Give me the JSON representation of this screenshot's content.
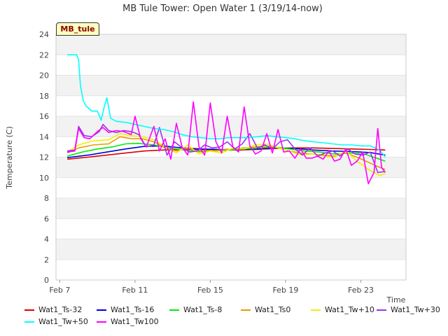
{
  "chart_data": {
    "type": "line",
    "title": "MB Tule Tower: Open Water 1 (3/19/14-now)",
    "xlabel": "Time",
    "ylabel": "Temperature (C)",
    "ylim": [
      0,
      24
    ],
    "yticks": [
      0,
      2,
      4,
      6,
      8,
      10,
      12,
      14,
      16,
      18,
      20,
      22,
      24
    ],
    "xlim": [
      6.8,
      25.4
    ],
    "xticks": [
      {
        "v": 7,
        "label": "Feb 7"
      },
      {
        "v": 11,
        "label": "Feb 11"
      },
      {
        "v": 15,
        "label": "Feb 15"
      },
      {
        "v": 19,
        "label": "Feb 19"
      },
      {
        "v": 23,
        "label": "Feb 23"
      }
    ],
    "badge": "MB_tule",
    "series": [
      {
        "name": "Wat1_Ts-32",
        "color": "#dd0000",
        "x": [
          7.4,
          8.5,
          9.5,
          10.5,
          11.5,
          12.5,
          13.5,
          14.5,
          15.5,
          16.5,
          17.5,
          18.5,
          19.5,
          20.5,
          21.5,
          22.5,
          23.5,
          24.3
        ],
        "y": [
          11.8,
          12.0,
          12.2,
          12.4,
          12.6,
          12.7,
          12.75,
          12.75,
          12.7,
          12.7,
          12.75,
          12.85,
          12.9,
          12.9,
          12.85,
          12.8,
          12.75,
          12.7
        ]
      },
      {
        "name": "Wat1_Ts-16",
        "color": "#0000dd",
        "x": [
          7.4,
          8.5,
          9.5,
          10.5,
          11.5,
          12.5,
          13.5,
          14.5,
          15.5,
          16.5,
          17.5,
          18.5,
          19.5,
          20.5,
          21.5,
          22.5,
          23.5,
          24.3
        ],
        "y": [
          11.95,
          12.2,
          12.5,
          12.8,
          13.05,
          13.1,
          12.9,
          12.8,
          12.75,
          12.75,
          12.8,
          12.9,
          12.85,
          12.7,
          12.6,
          12.55,
          12.45,
          12.2
        ]
      },
      {
        "name": "Wat1_Ts-8",
        "color": "#00ee00",
        "x": [
          7.4,
          8.2,
          9.0,
          9.8,
          10.5,
          11.2,
          12.0,
          12.8,
          13.6,
          14.4,
          15.2,
          16.0,
          16.8,
          17.6,
          18.4,
          19.2,
          20.0,
          20.8,
          21.6,
          22.4,
          23.2,
          24.3
        ],
        "y": [
          12.1,
          12.5,
          12.8,
          13.0,
          13.3,
          13.35,
          13.2,
          12.9,
          12.7,
          12.6,
          12.6,
          12.7,
          12.8,
          12.9,
          13.0,
          12.8,
          12.6,
          12.5,
          12.3,
          12.4,
          12.3,
          11.6
        ]
      },
      {
        "name": "Wat1_Ts0",
        "color": "#ee9900",
        "x": [
          7.4,
          8.0,
          8.8,
          9.6,
          10.2,
          10.8,
          11.4,
          12.0,
          12.6,
          13.2,
          13.8,
          14.4,
          15.0,
          15.6,
          16.2,
          16.8,
          17.4,
          18.0,
          18.6,
          19.2,
          19.8,
          20.4,
          21.0,
          21.6,
          22.2,
          22.8,
          23.4,
          24.0,
          24.3
        ],
        "y": [
          12.4,
          12.9,
          13.2,
          13.3,
          14.0,
          13.8,
          13.8,
          13.5,
          12.9,
          12.6,
          12.9,
          12.5,
          12.6,
          12.7,
          12.8,
          12.9,
          13.0,
          13.1,
          12.9,
          12.6,
          12.4,
          12.3,
          12.2,
          12.1,
          12.4,
          12.0,
          11.5,
          11.0,
          10.8
        ]
      },
      {
        "name": "Wat1_Tw+10",
        "color": "#f0f000",
        "x": [
          7.4,
          8.0,
          8.8,
          9.6,
          10.2,
          10.8,
          11.4,
          12.0,
          12.6,
          13.2,
          13.8,
          14.4,
          15.0,
          15.6,
          16.2,
          16.8,
          17.4,
          18.0,
          18.6,
          19.2,
          19.8,
          20.4,
          21.0,
          21.6,
          22.2,
          22.8,
          23.4,
          24.0,
          24.3
        ],
        "y": [
          12.5,
          13.2,
          13.6,
          13.7,
          14.3,
          14.1,
          14.0,
          13.7,
          13.0,
          12.4,
          13.2,
          12.3,
          12.6,
          12.4,
          12.9,
          12.8,
          13.2,
          13.3,
          12.9,
          12.6,
          12.2,
          12.3,
          12.1,
          12.0,
          12.6,
          11.6,
          10.8,
          10.2,
          10.4
        ]
      },
      {
        "name": "Wat1_Tw+30",
        "color": "#9933ee",
        "x": [
          7.4,
          7.8,
          8.0,
          8.3,
          8.7,
          9.1,
          9.3,
          9.6,
          10.0,
          10.4,
          10.8,
          11.2,
          11.6,
          12.0,
          12.3,
          12.7,
          13.1,
          13.5,
          13.9,
          14.3,
          14.7,
          15.1,
          15.5,
          15.9,
          16.3,
          16.7,
          17.1,
          17.5,
          17.9,
          18.3,
          18.7,
          19.1,
          19.5,
          19.9,
          20.3,
          20.7,
          21.1,
          21.5,
          21.9,
          22.3,
          22.7,
          23.1,
          23.5,
          23.9,
          24.3
        ],
        "y": [
          12.6,
          12.7,
          15.0,
          14.1,
          14.0,
          14.5,
          15.2,
          14.6,
          14.4,
          14.6,
          14.5,
          14.2,
          13.0,
          13.2,
          14.9,
          12.2,
          13.5,
          12.9,
          12.5,
          12.6,
          13.2,
          12.9,
          13.0,
          13.5,
          12.8,
          13.3,
          14.3,
          12.9,
          13.2,
          12.8,
          13.5,
          13.7,
          12.8,
          12.2,
          12.9,
          12.1,
          12.4,
          12.6,
          12.1,
          12.8,
          12.3,
          12.2,
          12.5,
          10.5,
          10.6
        ]
      },
      {
        "name": "Wat1_Tw+50",
        "color": "#00ffff",
        "x": [
          7.4,
          7.9,
          8.0,
          8.1,
          8.25,
          8.4,
          8.7,
          9.0,
          9.2,
          9.35,
          9.5,
          9.7,
          10.0,
          10.5,
          11.0,
          11.5,
          12.0,
          12.5,
          13.0,
          13.5,
          14.0,
          14.5,
          15.0,
          15.5,
          16.0,
          16.5,
          17.0,
          17.5,
          18.0,
          18.5,
          19.0,
          19.5,
          20.0,
          20.5,
          21.0,
          21.5,
          22.0,
          22.5,
          23.0,
          23.5,
          24.0,
          24.3
        ],
        "y": [
          22.0,
          22.0,
          21.5,
          19.0,
          17.5,
          17.0,
          16.5,
          16.5,
          15.6,
          16.8,
          17.8,
          15.8,
          15.5,
          15.4,
          15.2,
          15.0,
          14.8,
          14.7,
          14.5,
          14.2,
          14.0,
          13.9,
          13.8,
          13.8,
          13.9,
          13.9,
          13.9,
          14.0,
          14.1,
          14.0,
          13.9,
          13.8,
          13.6,
          13.5,
          13.4,
          13.3,
          13.2,
          13.2,
          13.1,
          13.1,
          12.7,
          12.0
        ]
      },
      {
        "name": "Wat1_Tw100",
        "color": "#ff00ff",
        "x": [
          7.4,
          7.8,
          8.0,
          8.3,
          8.6,
          9.0,
          9.3,
          9.6,
          10.0,
          10.4,
          10.8,
          11.0,
          11.3,
          11.6,
          12.0,
          12.3,
          12.6,
          12.9,
          13.2,
          13.5,
          13.8,
          14.1,
          14.4,
          14.7,
          15.0,
          15.3,
          15.6,
          15.9,
          16.2,
          16.5,
          16.8,
          17.1,
          17.4,
          17.7,
          18.0,
          18.3,
          18.6,
          18.9,
          19.2,
          19.5,
          19.8,
          20.1,
          20.4,
          20.7,
          21.0,
          21.3,
          21.6,
          21.9,
          22.2,
          22.5,
          22.8,
          23.1,
          23.4,
          23.7,
          23.9,
          24.1,
          24.3
        ],
        "y": [
          12.5,
          12.6,
          14.8,
          13.9,
          13.8,
          14.5,
          14.9,
          14.4,
          14.6,
          14.5,
          14.2,
          16.0,
          13.8,
          13.0,
          15.0,
          12.6,
          13.8,
          11.8,
          15.3,
          13.0,
          12.2,
          17.4,
          13.0,
          12.2,
          17.3,
          13.5,
          12.4,
          16.0,
          13.0,
          12.5,
          16.9,
          13.1,
          12.3,
          12.6,
          14.3,
          12.4,
          14.7,
          12.5,
          12.6,
          11.9,
          12.8,
          11.9,
          11.9,
          12.1,
          11.8,
          12.6,
          11.6,
          11.8,
          12.8,
          11.2,
          11.6,
          12.5,
          9.4,
          10.5,
          14.8,
          11.0,
          10.5
        ]
      }
    ]
  }
}
